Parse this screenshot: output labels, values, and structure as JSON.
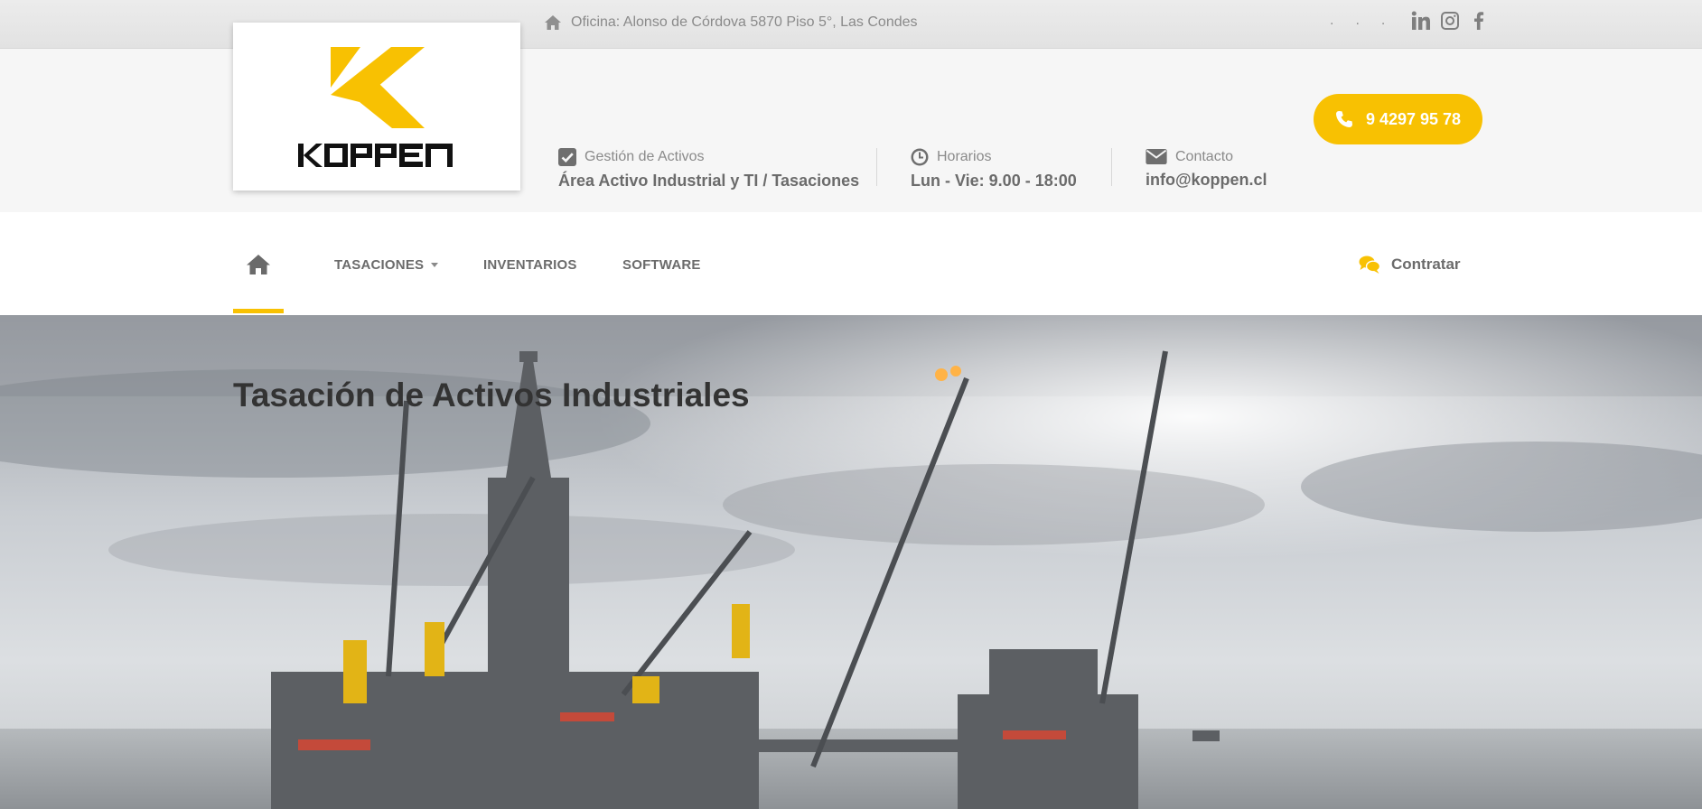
{
  "topbar": {
    "address": "Oficina: Alonso de Córdova 5870 Piso 5°, Las Condes",
    "dots": [
      ".",
      ".",
      "."
    ],
    "social_icons": [
      "linkedin-icon",
      "instagram-icon",
      "facebook-icon"
    ]
  },
  "logo": {
    "wordmark": "KOPPEN"
  },
  "info": [
    {
      "icon": "check-square-icon",
      "label": "Gestión de Activos",
      "value": "Área Activo Industrial y TI / Tasaciones"
    },
    {
      "icon": "clock-icon",
      "label": "Horarios",
      "value": "Lun - Vie: 9.00 - 18:00"
    },
    {
      "icon": "envelope-icon",
      "label": "Contacto",
      "value": "info@koppen.cl"
    }
  ],
  "phone_button": {
    "label": "9 4297 95 78",
    "icon": "phone-icon"
  },
  "nav": {
    "items": [
      {
        "label": "TASACIONES",
        "has_dropdown": true
      },
      {
        "label": "INVENTARIOS"
      },
      {
        "label": "SOFTWARE"
      }
    ],
    "cta": {
      "label": "Contratar",
      "icon": "comments-icon"
    }
  },
  "hero": {
    "title": "Tasación de Activos Industriales"
  },
  "colors": {
    "accent": "#f8c102",
    "text": "#6b6b6b",
    "header_bg": "#f6f6f6",
    "topbar_bg": "#e6e6e6"
  }
}
